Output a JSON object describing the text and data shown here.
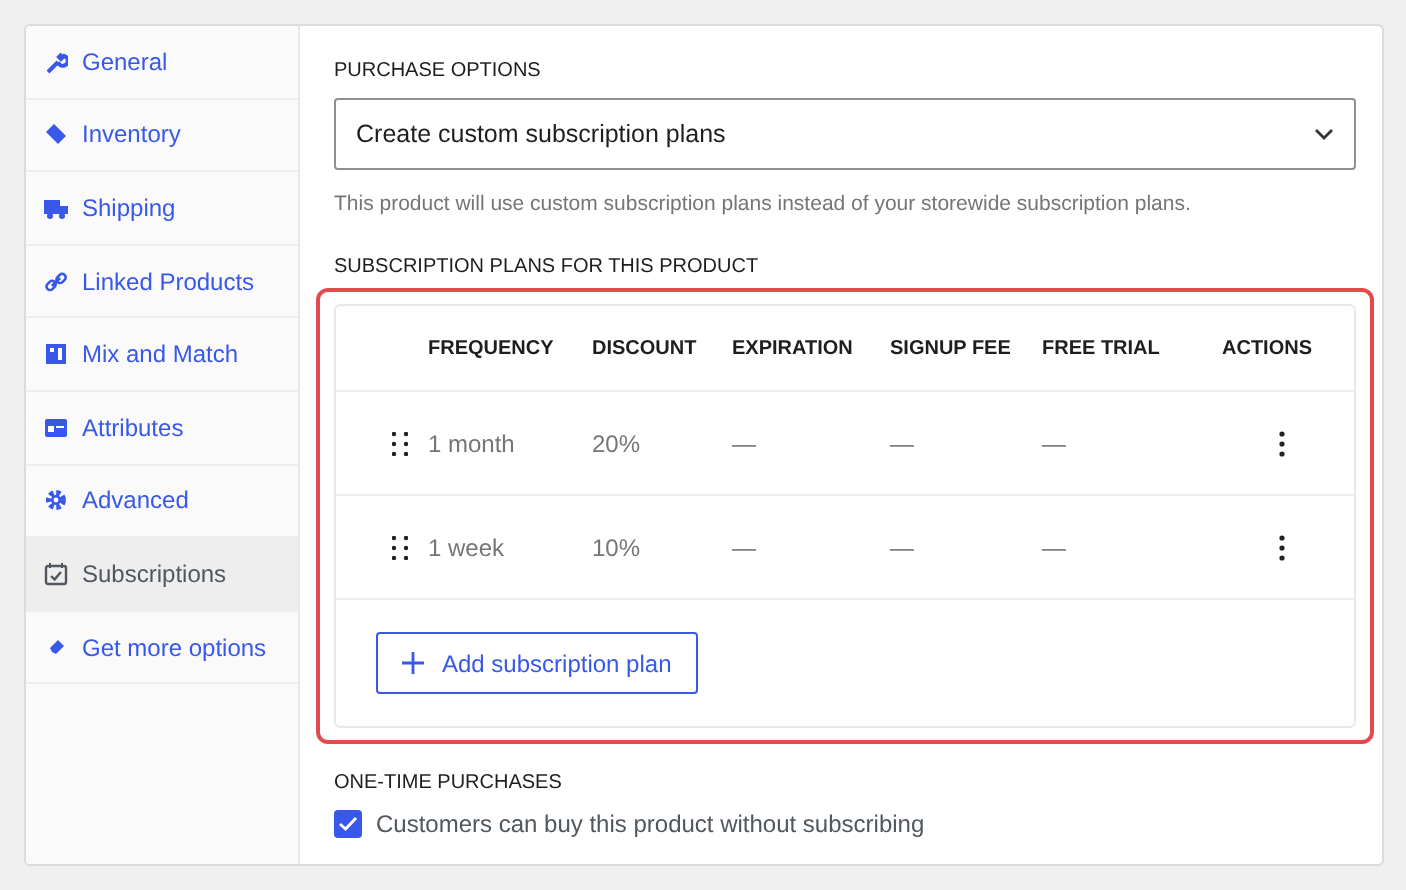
{
  "sidebar": {
    "items": [
      {
        "label": "General",
        "selected": false
      },
      {
        "label": "Inventory",
        "selected": false
      },
      {
        "label": "Shipping",
        "selected": false
      },
      {
        "label": "Linked Products",
        "selected": false
      },
      {
        "label": "Mix and Match",
        "selected": false
      },
      {
        "label": "Attributes",
        "selected": false
      },
      {
        "label": "Advanced",
        "selected": false
      },
      {
        "label": "Subscriptions",
        "selected": true
      },
      {
        "label": "Get more options",
        "selected": false
      }
    ]
  },
  "purchase_options": {
    "heading": "PURCHASE OPTIONS",
    "value": "Create custom subscription plans",
    "help": "This product will use custom subscription plans instead of your storewide subscription plans."
  },
  "plans": {
    "heading": "SUBSCRIPTION PLANS FOR THIS PRODUCT",
    "columns": [
      "FREQUENCY",
      "DISCOUNT",
      "EXPIRATION",
      "SIGNUP FEE",
      "FREE TRIAL",
      "ACTIONS"
    ],
    "rows": [
      {
        "frequency": "1 month",
        "discount": "20%",
        "expiration": "—",
        "signup_fee": "—",
        "free_trial": "—"
      },
      {
        "frequency": "1 week",
        "discount": "10%",
        "expiration": "—",
        "signup_fee": "—",
        "free_trial": "—"
      }
    ],
    "add_button": "Add subscription plan"
  },
  "one_time": {
    "heading": "ONE-TIME PURCHASES",
    "label": "Customers can buy this product without subscribing",
    "checked": true
  }
}
